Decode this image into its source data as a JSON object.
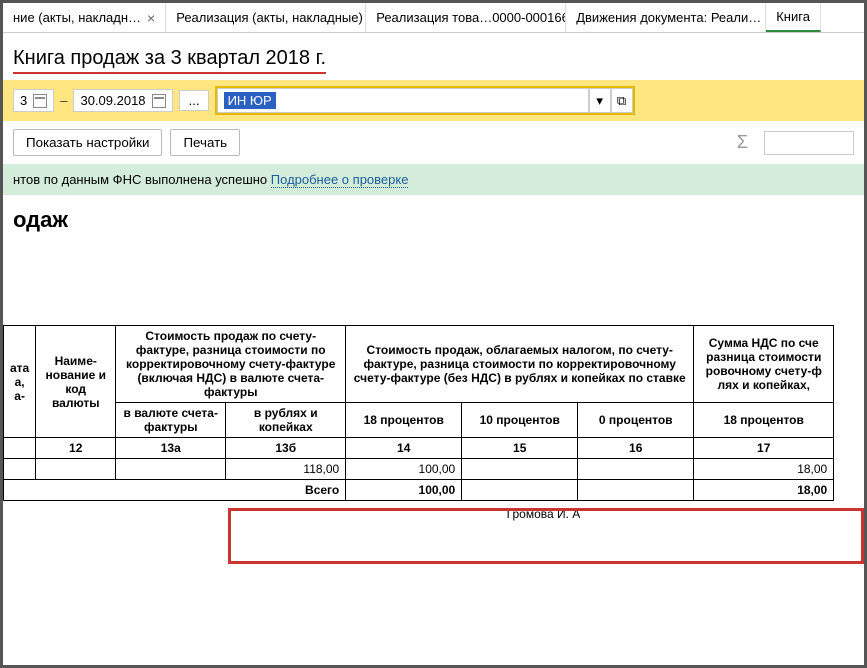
{
  "tabs": [
    {
      "label": "ние (акты, накладн…"
    },
    {
      "label": "Реализация (акты, накладные)"
    },
    {
      "label": "Реализация това…0000-000166"
    },
    {
      "label": "Движения документа: Реали…"
    },
    {
      "label": "Книга"
    }
  ],
  "title": "Книга продаж за 3 квартал 2018 г.",
  "toolbar": {
    "date_left": "3",
    "date_right": "30.09.2018",
    "ellipsis": "...",
    "input_value": "ИН ЮР",
    "dropdown_arrow": "▾",
    "expand_icon": "⧉"
  },
  "buttons": {
    "show_settings": "Показать настройки",
    "print": "Печать",
    "sigma": "Σ"
  },
  "info_bar": {
    "text_prefix": "нтов по данным ФНС выполнена успешно ",
    "link": "Подробнее о проверке"
  },
  "section_header": "одаж",
  "table": {
    "h_col0": "ата\nа,\nа-",
    "h_col1": "Наиме-\nнование\nи код\nвалюты",
    "h_group1": "Стоимость продаж по счету-фактуре, разница стоимости по корректировочному счету-фактуре (включая НДС) в валюте счета-фактуры",
    "h_group2": "Стоимость продаж, облагаемых налогом, по счету-фактуре, разница стоимости по корректи­ровочному счету-фактуре (без НДС) в рублях и копейках по ставке",
    "h_group3": "Сумма НДС по сче\nразница стоимости\nровочному счету-ф\nлях и копейках,",
    "sub_13a": "в валюте счета-фактуры",
    "sub_13b": "в рублях и копейках",
    "sub_14": "18 процентов",
    "sub_15": "10 процентов",
    "sub_16": "0 процентов",
    "sub_17": "18 процентов",
    "num_12": "12",
    "num_13a": "13а",
    "num_13b": "13б",
    "num_14": "14",
    "num_15": "15",
    "num_16": "16",
    "num_17": "17",
    "val_13b": "118,00",
    "val_14": "100,00",
    "val_17": "18,00",
    "total_label": "Всего",
    "total_14": "100,00",
    "total_17": "18,00"
  },
  "footer": "Громова И. А",
  "chart_data": {
    "type": "table",
    "title": "Книга продаж за 3 квартал 2018 г.",
    "columns": [
      "12",
      "13а",
      "13б",
      "14",
      "15",
      "16",
      "17"
    ],
    "column_labels": [
      "Наименование и код валюты",
      "в валюте счета-фактуры",
      "в рублях и копейках",
      "18 процентов",
      "10 процентов",
      "0 процентов",
      "18 процентов (НДС)"
    ],
    "rows": [
      {
        "13б": 118.0,
        "14": 100.0,
        "17": 18.0
      }
    ],
    "totals": {
      "14": 100.0,
      "17": 18.0
    }
  }
}
